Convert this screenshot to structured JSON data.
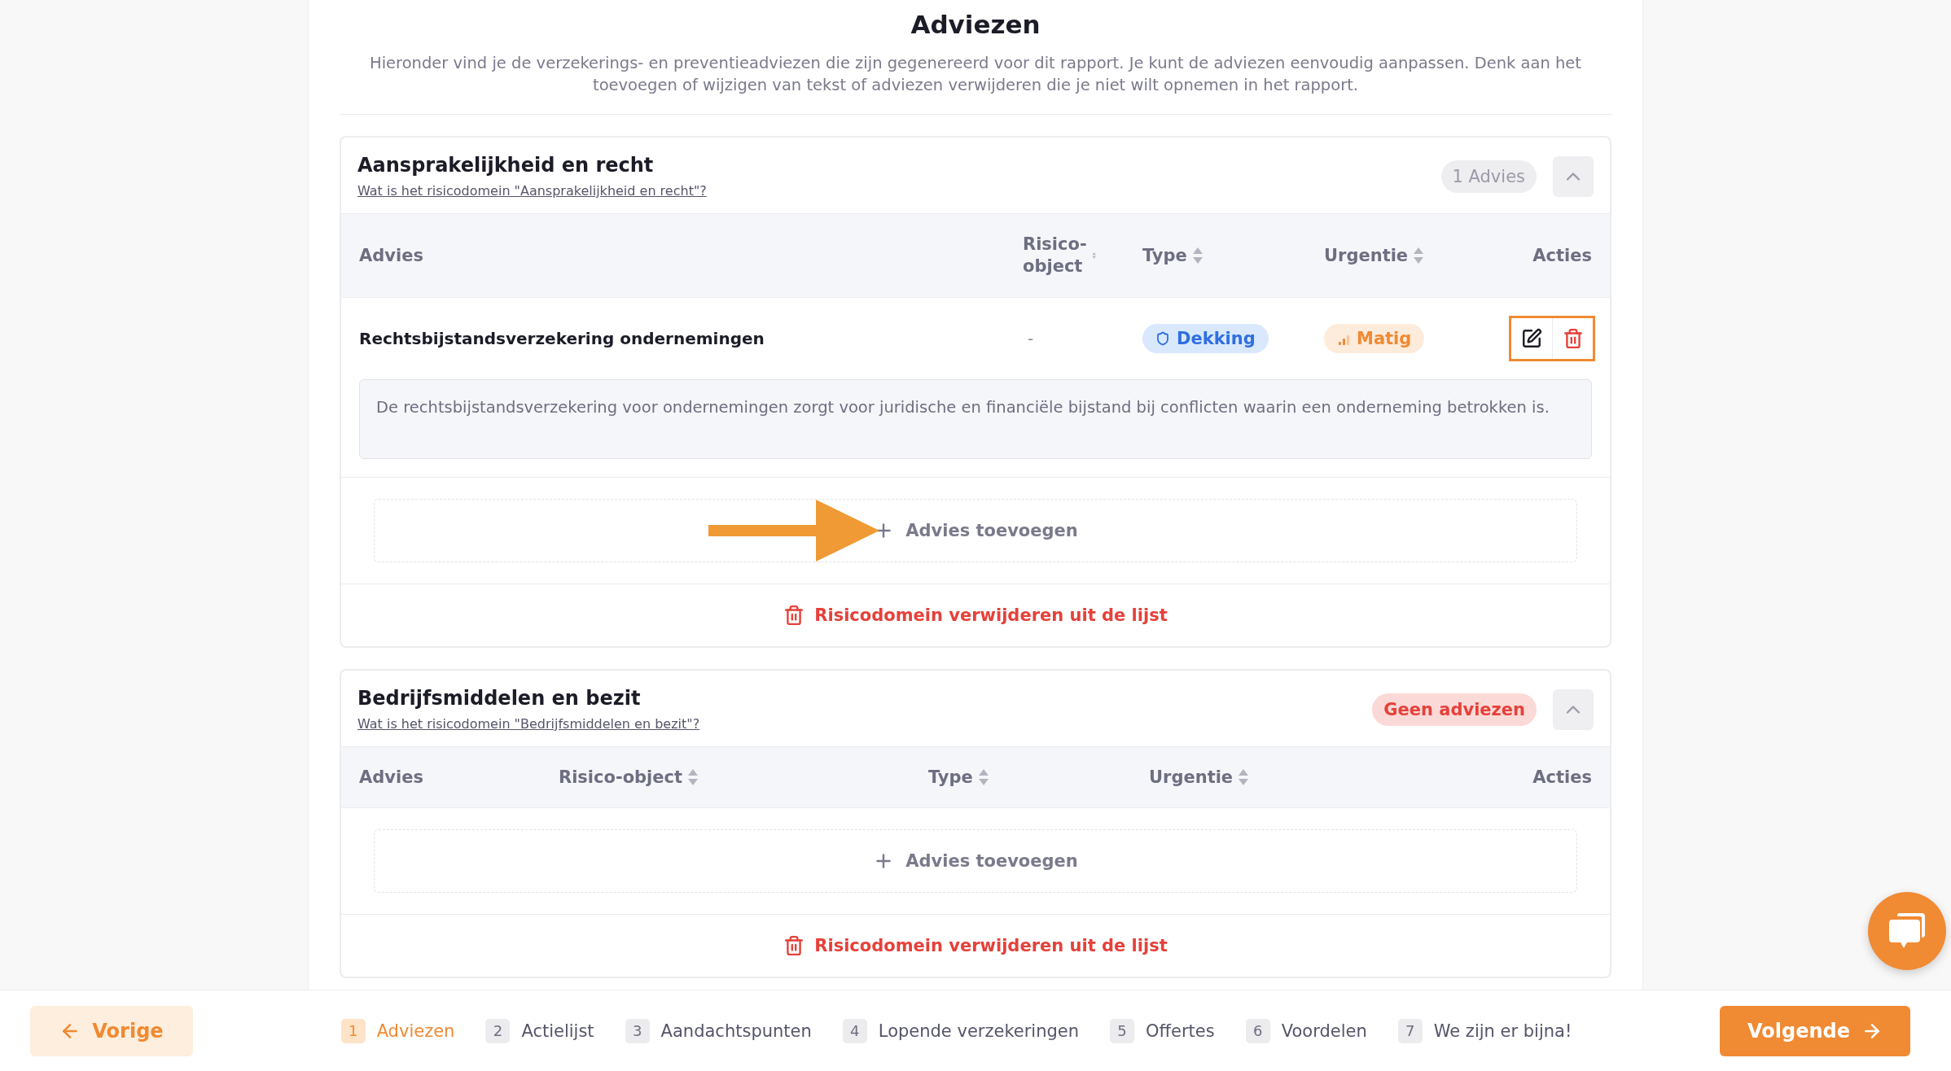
{
  "page": {
    "title": "Adviezen",
    "intro": "Hieronder vind je de verzekerings- en preventieadviezen die zijn gegenereerd voor dit rapport. Je kunt de adviezen eenvoudig aanpassen. Denk aan het toevoegen of wijzigen van tekst of adviezen verwijderen die je niet wilt opnemen in het rapport."
  },
  "domains": [
    {
      "title": "Aansprakelijkheid en recht",
      "info_link": "Wat is het risicodomein \"Aansprakelijkheid en recht\"?",
      "badge": {
        "text": "1 Advies",
        "kind": "count"
      },
      "expanded": true,
      "columns": [
        {
          "label": "Advies",
          "sortable": false
        },
        {
          "label": "Risico-object",
          "sortable": true
        },
        {
          "label": "Type",
          "sortable": true
        },
        {
          "label": "Urgentie",
          "sortable": true
        },
        {
          "label": "Acties",
          "sortable": false
        }
      ],
      "rows": [
        {
          "advice": "Rechtsbijstandsverzekering ondernemingen",
          "risk_object": "-",
          "type": {
            "label": "Dekking",
            "kind": "coverage"
          },
          "urgency": {
            "label": "Matig",
            "kind": "medium"
          },
          "description": "De rechtsbijstandsverzekering voor ondernemingen zorgt voor juridische en financiële bijstand bij conflicten waarin een onderneming betrokken is.",
          "highlighted": true
        }
      ],
      "add_label": "Advies toevoegen",
      "add_arrow": true,
      "remove_label": "Risicodomein verwijderen uit de lijst"
    },
    {
      "title": "Bedrijfsmiddelen en bezit",
      "info_link": "Wat is het risicodomein \"Bedrijfsmiddelen en bezit\"?",
      "badge": {
        "text": "Geen adviezen",
        "kind": "empty"
      },
      "expanded": true,
      "columns": [
        {
          "label": "Advies",
          "sortable": false
        },
        {
          "label": "Risico-object",
          "sortable": true
        },
        {
          "label": "Type",
          "sortable": true
        },
        {
          "label": "Urgentie",
          "sortable": true
        },
        {
          "label": "Acties",
          "sortable": false
        }
      ],
      "add_label": "Advies toevoegen",
      "add_arrow": false,
      "remove_label": "Risicodomein verwijderen uit de lijst"
    }
  ],
  "footer": {
    "prev": "Vorige",
    "next": "Volgende",
    "steps": [
      {
        "number": "1",
        "label": "Adviezen",
        "selected": true
      },
      {
        "number": "2",
        "label": "Actielijst",
        "selected": false
      },
      {
        "number": "3",
        "label": "Aandachtspunten",
        "selected": false
      },
      {
        "number": "4",
        "label": "Lopende verzekeringen",
        "selected": false
      },
      {
        "number": "5",
        "label": "Offertes",
        "selected": false
      },
      {
        "number": "6",
        "label": "Voordelen",
        "selected": false
      },
      {
        "number": "7",
        "label": "We zijn er bijna!",
        "selected": false
      }
    ]
  }
}
